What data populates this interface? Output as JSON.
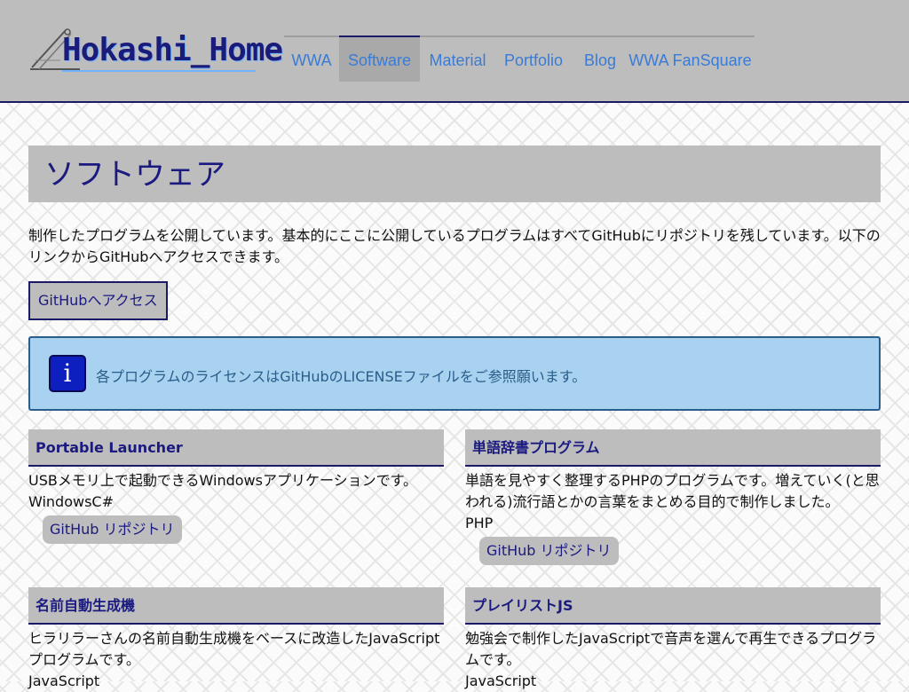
{
  "header": {
    "logo_text": "Hokashi_Home",
    "nav": [
      {
        "label": "WWA"
      },
      {
        "label": "Software"
      },
      {
        "label": "Material"
      },
      {
        "label": "Portfolio"
      },
      {
        "label": "Blog"
      },
      {
        "label": "WWA FanSquare"
      }
    ],
    "active_nav": "Software"
  },
  "page": {
    "title": "ソフトウェア",
    "intro": "制作したプログラムを公開しています。基本的にここに公開しているプログラムはすべてGitHubにリポジトリを残しています。以下のリンクからGitHubへアクセスできます。",
    "github_button": "GitHubへアクセス",
    "info": "各プログラムのライセンスはGitHubのLICENSEファイルをご参照願います。",
    "info_icon": "i"
  },
  "cards": [
    {
      "title": "Portable Launcher",
      "desc": "USBメモリ上で起動できるWindowsアプリケーションです。",
      "lang": "WindowsC#",
      "button": "GitHub リポジトリ"
    },
    {
      "title": "単語辞書プログラム",
      "desc": "単語を見やすく整理するPHPのプログラムです。増えていく(と思われる)流行語とかの言葉をまとめる目的で制作しました。",
      "lang": "PHP",
      "button": "GitHub リポジトリ"
    },
    {
      "title": "名前自動生成機",
      "desc": "ヒラリラーさんの名前自動生成機をベースに改造したJavaScriptプログラムです。",
      "lang": "JavaScript"
    },
    {
      "title": "プレイリストJS",
      "desc": "勉強会で制作したJavaScriptで音声を選んで再生できるプログラムです。",
      "lang": "JavaScript"
    }
  ],
  "colors": {
    "header_bg": "#bdbdbd",
    "accent": "#1a1a80",
    "nav_link": "#3a7bd5",
    "info_bg": "#a8d2ef"
  }
}
